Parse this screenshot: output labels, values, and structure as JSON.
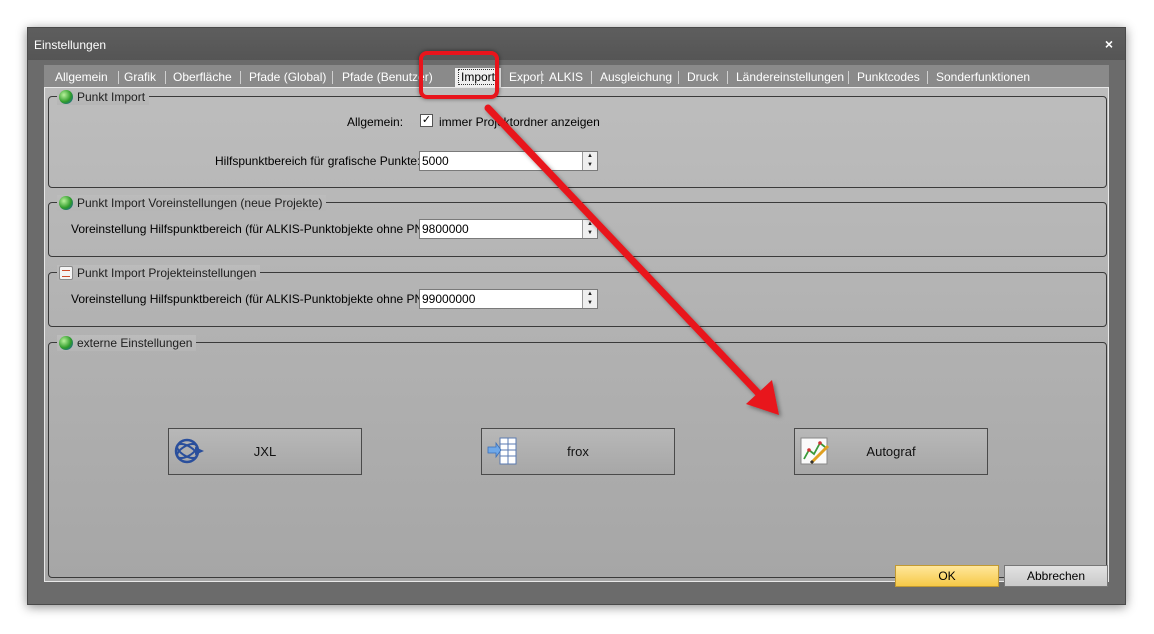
{
  "window": {
    "title": "Einstellungen",
    "close_glyph": "×"
  },
  "tabs": [
    {
      "label": "Allgemein"
    },
    {
      "label": "Grafik"
    },
    {
      "label": "Oberfläche"
    },
    {
      "label": "Pfade (Global)"
    },
    {
      "label": "Pfade (Benutzer)"
    },
    {
      "label": "Import"
    },
    {
      "label": "Export"
    },
    {
      "label": "ALKIS"
    },
    {
      "label": "Ausgleichung"
    },
    {
      "label": "Druck"
    },
    {
      "label": "Ländereinstellungen"
    },
    {
      "label": "Punktcodes"
    },
    {
      "label": "Sonderfunktionen"
    }
  ],
  "active_tab": "Import",
  "groups": {
    "punkt_import": {
      "title": "Punkt Import",
      "allgemein_label": "Allgemein:",
      "checkbox_label": "immer Projektordner anzeigen",
      "checkbox_checked": true,
      "hilfspunkt_label": "Hilfspunktbereich für grafische Punkte:",
      "hilfspunkt_value": "5000"
    },
    "voreinstellungen": {
      "title": "Punkt Import Voreinstellungen (neue Projekte)",
      "label": "Voreinstellung Hilfspunktbereich (für ALKIS-Punktobjekte ohne PNR):",
      "value": "9800000"
    },
    "projekteinstellungen": {
      "title": "Punkt Import Projekteinstellungen",
      "label": "Voreinstellung Hilfspunktbereich (für ALKIS-Punktobjekte ohne PNR):",
      "value": "99000000"
    },
    "extern": {
      "title": "externe Einstellungen",
      "buttons": [
        {
          "label": "JXL",
          "icon": "trimble-globe-icon"
        },
        {
          "label": "frox",
          "icon": "frox-table-icon"
        },
        {
          "label": "Autograf",
          "icon": "autograf-chart-icon"
        }
      ]
    }
  },
  "footer": {
    "ok_label": "OK",
    "cancel_label": "Abbrechen"
  },
  "colors": {
    "annotation_red": "#e8141c",
    "ok_button": "#f6c948",
    "window_bg": "#6b6b6b"
  }
}
